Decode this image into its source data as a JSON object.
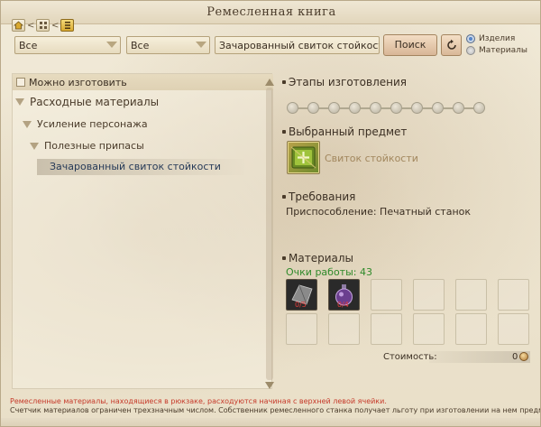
{
  "window": {
    "title": "Ремесленная книга"
  },
  "nav": {
    "separator": "<"
  },
  "toolbar": {
    "filter1_value": "Все",
    "filter2_value": "Все",
    "search_value": "Зачарованный свиток стойкости",
    "search_button": "Поиск",
    "radio_items": "Изделия",
    "radio_materials": "Материалы"
  },
  "left": {
    "filter_label": "Можно изготовить",
    "tree": {
      "category": "Расходные материалы",
      "subcategory": "Усиление персонажа",
      "group": "Полезные припасы",
      "selected_item": "Зачарованный свиток стойкости"
    }
  },
  "right": {
    "stages_title": "Этапы изготовления",
    "stages_count": 10,
    "selected_title": "Выбранный предмет",
    "selected_item_name": "Свиток стойкости",
    "requirements_title": "Требования",
    "requirement_text": "Приспособление: Печатный станок",
    "materials_title": "Материалы",
    "work_points": "Очки работы: 43",
    "materials": [
      {
        "icon": "stone-slab-icon",
        "count": "0/5"
      },
      {
        "icon": "potion-flask-icon",
        "count": "0/4"
      }
    ],
    "cost_label": "Стоимость:",
    "cost_value": "0"
  },
  "footer": {
    "warning": "Ремесленные материалы, находящиеся в рюкзаке, расходуются начиная с верхней левой ячейки.",
    "note": "Счетчик материалов ограничен трехзначным числом. Собственник ремесленного станка получает льготу при изготовлении на нем предметов."
  },
  "colors": {
    "background": "#ece3cf",
    "selected_row": "#c3b9a5",
    "work_points_green": "#2f8a2a",
    "warning_red": "#c63a2a",
    "radio_active": "#5b88c9"
  }
}
